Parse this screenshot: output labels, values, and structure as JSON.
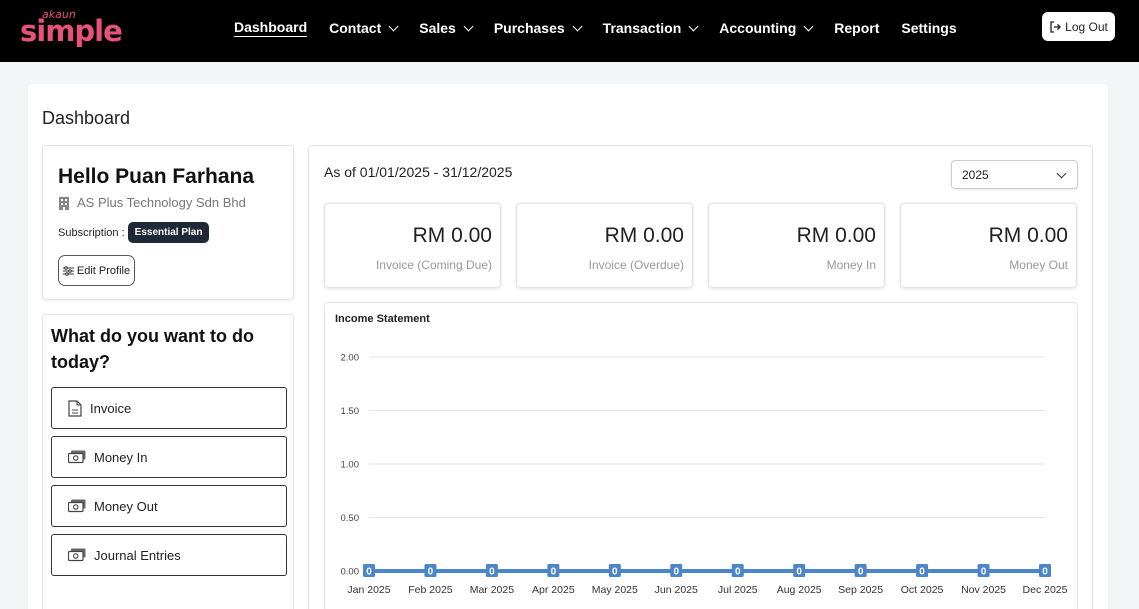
{
  "brand": {
    "small": "akaun",
    "big": "simple"
  },
  "nav": {
    "items": [
      {
        "label": "Dashboard",
        "active": true,
        "dropdown": false
      },
      {
        "label": "Contact",
        "active": false,
        "dropdown": true
      },
      {
        "label": "Sales",
        "active": false,
        "dropdown": true
      },
      {
        "label": "Purchases",
        "active": false,
        "dropdown": true
      },
      {
        "label": "Transaction",
        "active": false,
        "dropdown": true
      },
      {
        "label": "Accounting",
        "active": false,
        "dropdown": true
      },
      {
        "label": "Report",
        "active": false,
        "dropdown": false
      },
      {
        "label": "Settings",
        "active": false,
        "dropdown": false
      }
    ],
    "logout_label": "Log Out"
  },
  "page": {
    "title": "Dashboard"
  },
  "profile": {
    "greeting": "Hello Puan Farhana",
    "company": "AS Plus Technology Sdn Bhd",
    "subscription_label": "Subscription :",
    "plan": "Essential Plan",
    "edit_label": "Edit Profile"
  },
  "todo": {
    "title": "What do you want to do today?",
    "actions": [
      {
        "label": "Invoice",
        "icon": "document-icon"
      },
      {
        "label": "Money In",
        "icon": "cash-icon"
      },
      {
        "label": "Money Out",
        "icon": "cash-icon"
      },
      {
        "label": "Journal Entries",
        "icon": "cash-icon"
      }
    ]
  },
  "summary": {
    "as_of": "As of 01/01/2025 - 31/12/2025",
    "year": "2025",
    "stats": [
      {
        "amount": "RM 0.00",
        "label": "Invoice (Coming Due)"
      },
      {
        "amount": "RM 0.00",
        "label": "Invoice (Overdue)"
      },
      {
        "amount": "RM 0.00",
        "label": "Money In"
      },
      {
        "amount": "RM 0.00",
        "label": "Money Out"
      }
    ]
  },
  "chart_data": {
    "type": "line",
    "title": "Income Statement",
    "categories": [
      "Jan 2025",
      "Feb 2025",
      "Mar 2025",
      "Apr 2025",
      "May 2025",
      "Jun 2025",
      "Jul 2025",
      "Aug 2025",
      "Sep 2025",
      "Oct 2025",
      "Nov 2025",
      "Dec 2025"
    ],
    "series": [
      {
        "values": [
          0,
          0,
          0,
          0,
          0,
          0,
          0,
          0,
          0,
          0,
          0,
          0
        ],
        "color": "#4a86c8"
      }
    ],
    "yticks": [
      "0.00",
      "0.50",
      "1.00",
      "1.50",
      "2.00"
    ],
    "ylim": [
      0,
      2
    ],
    "grid": true
  }
}
